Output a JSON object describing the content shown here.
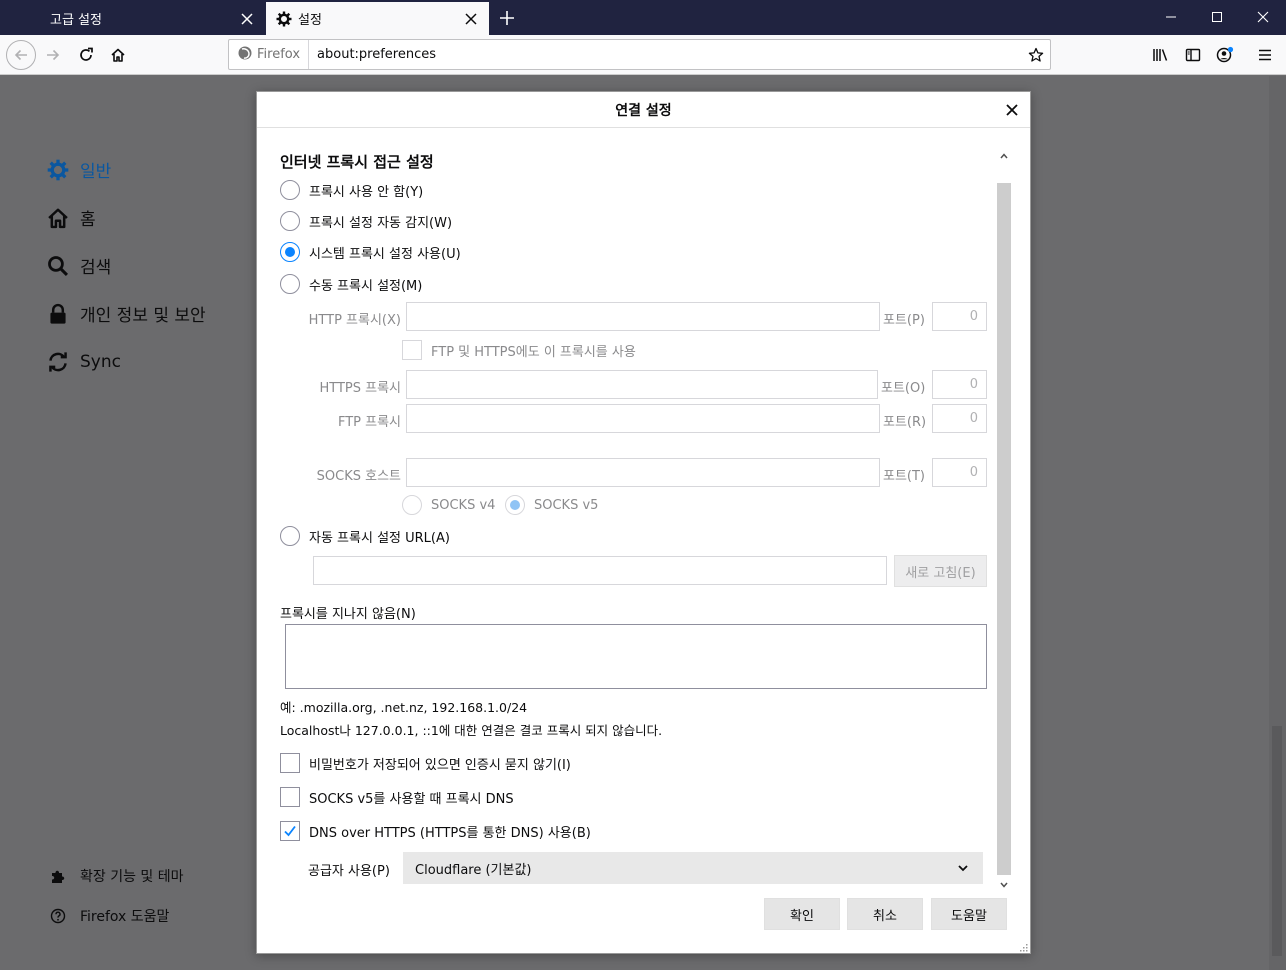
{
  "tabs": [
    {
      "label": "고급 설정",
      "active": false
    },
    {
      "label": "설정",
      "active": true
    }
  ],
  "urlbar": {
    "identity": "Firefox",
    "url": "about:preferences"
  },
  "sidebar": {
    "items": [
      {
        "label": "일반",
        "icon": "gear-icon",
        "selected": true
      },
      {
        "label": "홈",
        "icon": "home-icon"
      },
      {
        "label": "검색",
        "icon": "search-icon"
      },
      {
        "label": "개인 정보 및 보안",
        "icon": "lock-icon"
      },
      {
        "label": "Sync",
        "icon": "sync-icon"
      }
    ],
    "bottom": [
      {
        "label": "확장 기능 및 테마",
        "icon": "puzzle-icon"
      },
      {
        "label": "Firefox 도움말",
        "icon": "help-icon"
      }
    ]
  },
  "dialog": {
    "title": "연결 설정",
    "section_title": "인터넷 프록시 접근 설정",
    "proxy_options": [
      {
        "label": "프록시 사용 안 함(Y)",
        "checked": false
      },
      {
        "label": "프록시 설정 자동 감지(W)",
        "checked": false
      },
      {
        "label": "시스템 프록시 설정 사용(U)",
        "checked": true
      },
      {
        "label": "수동 프록시 설정(M)",
        "checked": false
      }
    ],
    "http_label": "HTTP 프록시(X)",
    "port_label_p": "포트(P)",
    "port_label_o": "포트(O)",
    "port_label_r": "포트(R)",
    "port_label_t": "포트(T)",
    "port_value": "0",
    "share_label": "FTP 및 HTTPS에도 이 프록시를 사용",
    "https_label": "HTTPS 프록시",
    "ftp_label": "FTP 프록시",
    "socks_label": "SOCKS 호스트",
    "socks_v4": "SOCKS v4",
    "socks_v5": "SOCKS v5",
    "auto_url_label": "자동 프록시 설정 URL(A)",
    "reload_label": "새로 고침(E)",
    "no_proxy_label": "프록시를 지나지 않음(N)",
    "example_text": "예: .mozilla.org, .net.nz, 192.168.1.0/24",
    "localhost_text": "Localhost나 127.0.0.1, ::1에 대한 연결은 결코 프록시 되지 않습니다.",
    "checks": [
      {
        "label": "비밀번호가 저장되어 있으면 인증시 묻지 않기(I)",
        "checked": false
      },
      {
        "label": "SOCKS v5를 사용할 때 프록시 DNS",
        "checked": false
      },
      {
        "label": "DNS over HTTPS (HTTPS를 통한 DNS) 사용(B)",
        "checked": true
      }
    ],
    "provider_label": "공급자 사용(P)",
    "provider_value": "Cloudflare (기본값)",
    "ok_label": "확인",
    "cancel_label": "취소",
    "help_label": "도움말"
  }
}
